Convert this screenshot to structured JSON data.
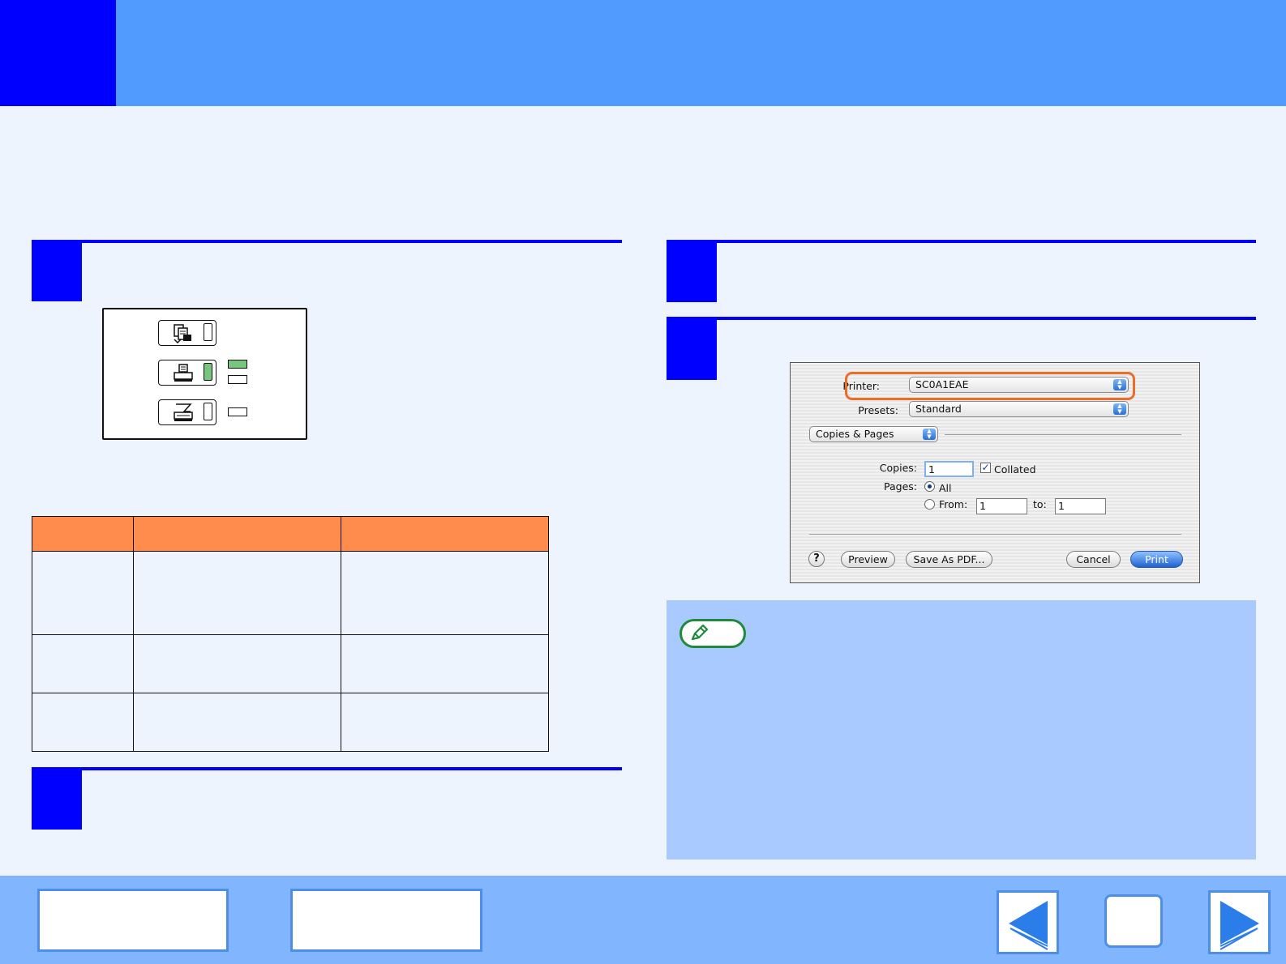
{
  "dialog": {
    "printer_label": "Printer:",
    "printer_value": "SC0A1EAE",
    "presets_label": "Presets:",
    "presets_value": "Standard",
    "section_value": "Copies & Pages",
    "copies_label": "Copies:",
    "copies_value": "1",
    "collated_label": "Collated",
    "collated_checked": true,
    "pages_label": "Pages:",
    "pages_all_label": "All",
    "pages_from_label": "From:",
    "pages_from_value": "1",
    "pages_to_label": "to:",
    "pages_to_value": "1",
    "help_label": "?",
    "preview_label": "Preview",
    "save_pdf_label": "Save As PDF...",
    "cancel_label": "Cancel",
    "print_label": "Print"
  },
  "colors": {
    "header": "#519bfe",
    "accent": "#0000fe",
    "table_header": "#ff8b4d",
    "note_box": "#a9cafe",
    "footer": "#81b5fd",
    "highlight": "#ef6b2a",
    "led_on": "#77c67f"
  },
  "panel": {
    "modes": [
      {
        "icon": "copy-mode-icon",
        "led_on": false
      },
      {
        "icon": "print-mode-icon",
        "led_on": true
      },
      {
        "icon": "scan-mode-icon",
        "led_on": false
      }
    ],
    "indicators": [
      {
        "on": true
      },
      {
        "on": false
      },
      {
        "on": false
      }
    ]
  },
  "footer": {
    "icons": [
      "back-arrow-icon",
      "home-icon",
      "forward-arrow-icon"
    ]
  }
}
